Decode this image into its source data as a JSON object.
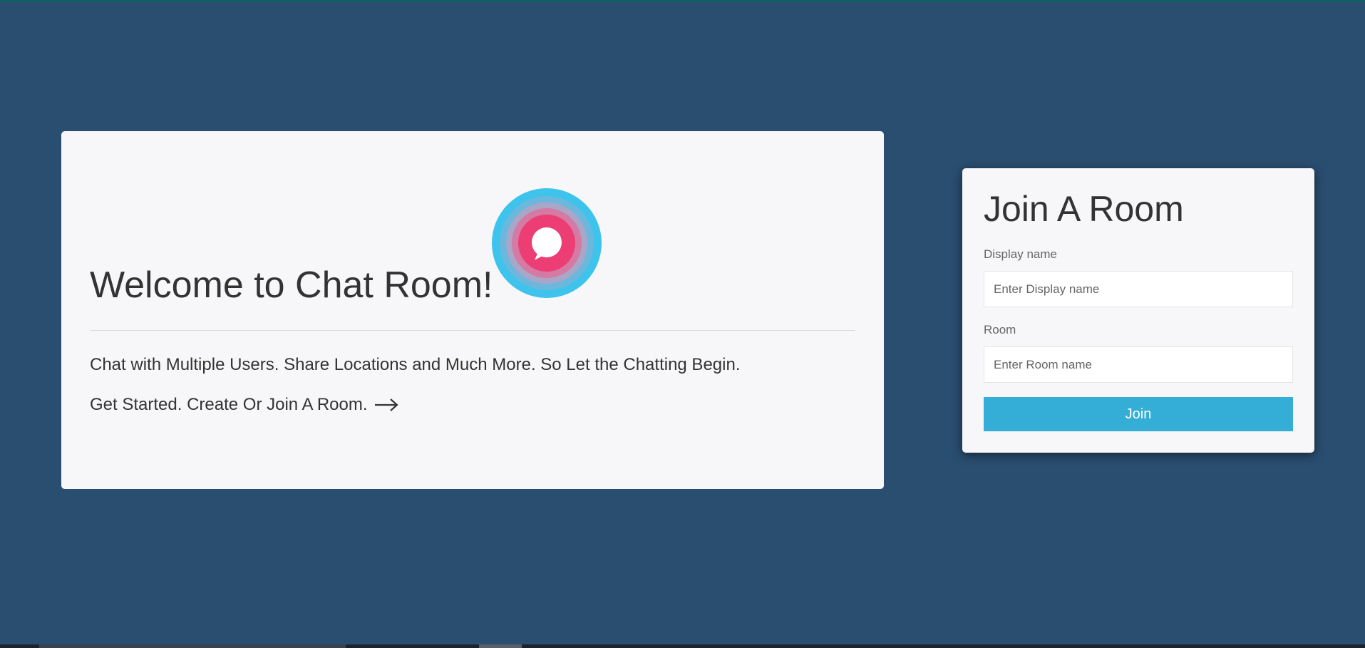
{
  "welcome": {
    "title": "Welcome to Chat Room!",
    "tagline": "Chat with Multiple Users. Share Locations and Much More. So Let the Chatting Begin.",
    "cta": "Get Started. Create Or Join A Room."
  },
  "join_form": {
    "title": "Join A Room",
    "display_name_label": "Display name",
    "display_name_placeholder": "Enter Display name",
    "display_name_value": "",
    "room_label": "Room",
    "room_placeholder": "Enter Room name",
    "room_value": "",
    "join_button_label": "Join"
  },
  "icons": {
    "logo": "chat-bubble-target-logo",
    "cta_arrow": "arrow-right-icon"
  },
  "colors": {
    "page_background": "#2a4e70",
    "card_background": "#f7f7f9",
    "button_accent": "#34aed6",
    "logo_outer": "#3dc3ec",
    "logo_inner": "#ec3d74"
  }
}
